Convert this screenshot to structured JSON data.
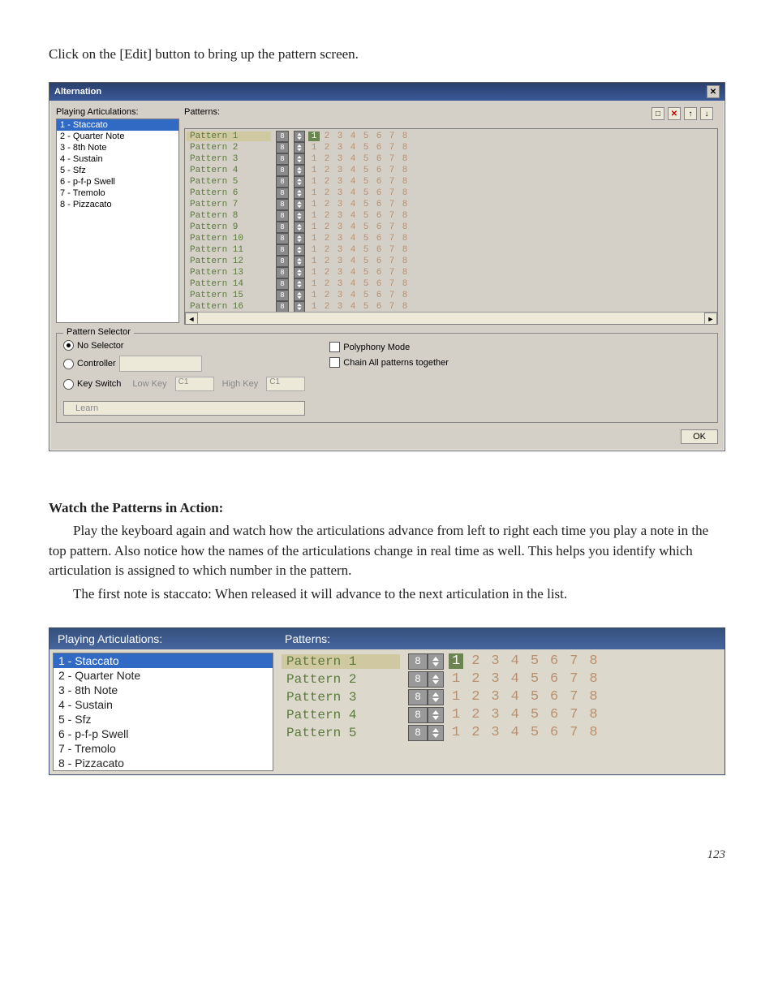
{
  "intro": "Click on the [Edit] button to bring up the pattern screen.",
  "alternation": {
    "title": "Alternation",
    "labels": {
      "playing_articulations": "Playing Articulations:",
      "patterns": "Patterns:"
    },
    "articulations": [
      "1 - Staccato",
      "2 - Quarter Note",
      "3 - 8th Note",
      "4 - Sustain",
      "5 - Sfz",
      "6 - p-f-p Swell",
      "7 - Tremolo",
      "8 - Pizzacato"
    ],
    "selected_articulation_index": 0,
    "toolbar": {
      "new": "□",
      "delete": "✕",
      "up": "↑",
      "down": "↓"
    },
    "pattern_count_value": "8",
    "step_numbers": [
      "1",
      "2",
      "3",
      "4",
      "5",
      "6",
      "7",
      "8"
    ],
    "highlight_step_index": 0,
    "patterns": [
      "Pattern 1",
      "Pattern 2",
      "Pattern 3",
      "Pattern 4",
      "Pattern 5",
      "Pattern 6",
      "Pattern 7",
      "Pattern 8",
      "Pattern 9",
      "Pattern 10",
      "Pattern 11",
      "Pattern 12",
      "Pattern 13",
      "Pattern 14",
      "Pattern 15",
      "Pattern 16"
    ],
    "selected_pattern_index": 0,
    "selector_group": {
      "legend": "Pattern Selector",
      "no_selector": "No Selector",
      "controller": "Controller",
      "key_switch": "Key Switch",
      "low_key_label": "Low Key",
      "low_key_value": "C1",
      "high_key_label": "High Key",
      "high_key_value": "C1",
      "polyphony": "Polyphony Mode",
      "chain": "Chain All patterns together",
      "learn": "Learn",
      "ok": "OK"
    }
  },
  "section_head": "Watch the Patterns in Action:",
  "para1": "Play the keyboard again and watch how the articulations advance from left to right each time you play a note in the top pattern.  Also notice how the names of the articulations change in real time as well.  This helps you identify which articulation is assigned to which number in the pattern.",
  "para2": "The first note is staccato:  When released it will advance to the next articulation in the list.",
  "fig2": {
    "header_left": "Playing Articulations:",
    "header_right": "Patterns:",
    "articulations": [
      "1 - Staccato",
      "2 - Quarter Note",
      "3 - 8th Note",
      "4 - Sustain",
      "5 - Sfz",
      "6 - p-f-p Swell",
      "7 - Tremolo",
      "8 - Pizzacato"
    ],
    "selected_art_index": 0,
    "pattern_count_value": "8",
    "steps": [
      "1",
      "2",
      "3",
      "4",
      "5",
      "6",
      "7",
      "8"
    ],
    "highlight_step_index": 0,
    "rows": [
      "Pattern 1",
      "Pattern 2",
      "Pattern 3",
      "Pattern 4",
      "Pattern 5"
    ],
    "selected_row_index": 0
  },
  "page_number": "123"
}
